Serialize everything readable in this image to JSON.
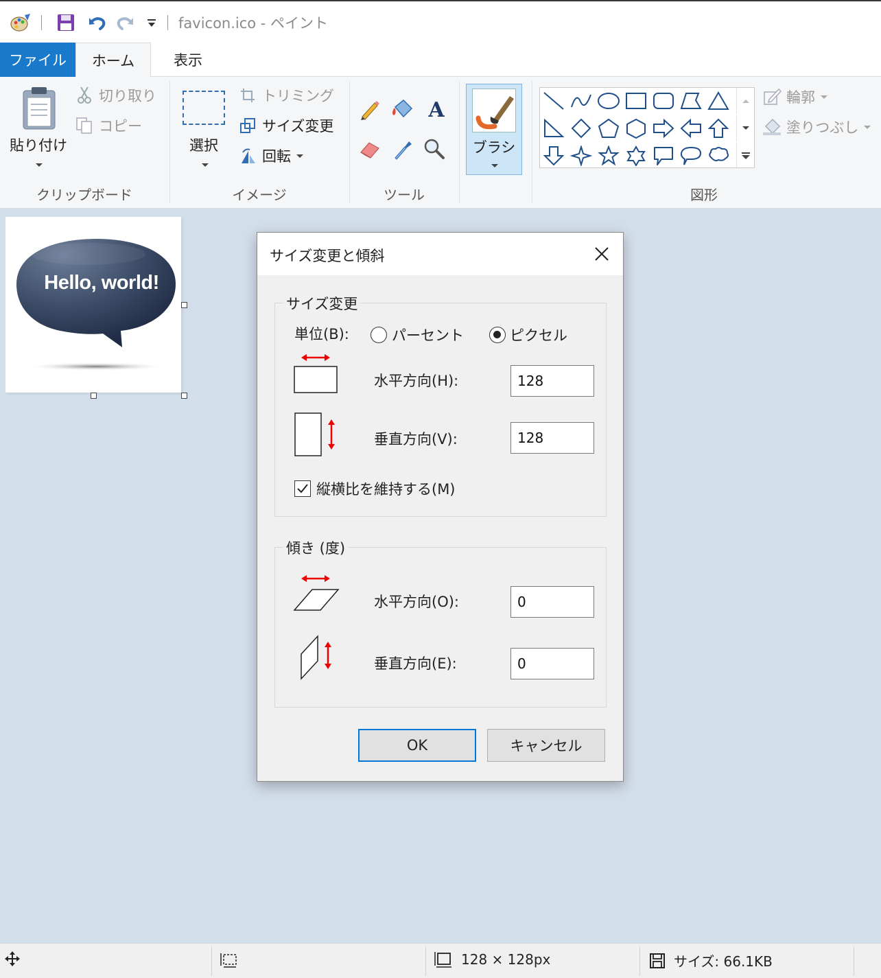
{
  "window": {
    "title": "favicon.ico - ペイント"
  },
  "tabs": {
    "file": "ファイル",
    "home": "ホーム",
    "view": "表示"
  },
  "ribbon": {
    "clipboard": {
      "paste": "貼り付け",
      "cut": "切り取り",
      "copy": "コピー",
      "group": "クリップボード"
    },
    "image": {
      "select": "選択",
      "crop": "トリミング",
      "resize": "サイズ変更",
      "rotate": "回転",
      "group": "イメージ"
    },
    "tools": {
      "group": "ツール"
    },
    "brush": {
      "label": "ブラシ"
    },
    "shapes": {
      "outline": "輪郭",
      "fill": "塗りつぶし",
      "group": "図形"
    }
  },
  "canvas": {
    "image_text": "Hello, world!"
  },
  "dialog": {
    "title": "サイズ変更と傾斜",
    "resize_section": {
      "legend": "サイズ変更",
      "unit_label": "単位(B):",
      "percent_option": "パーセント",
      "pixel_option": "ピクセル",
      "selected_unit": "ピクセル",
      "horizontal_label": "水平方向(H):",
      "horizontal_value": "128",
      "vertical_label": "垂直方向(V):",
      "vertical_value": "128",
      "keep_aspect_label": "縦横比を維持する(M)",
      "keep_aspect_checked": true
    },
    "skew_section": {
      "legend": "傾き (度)",
      "horizontal_label": "水平方向(O):",
      "horizontal_value": "0",
      "vertical_label": "垂直方向(E):",
      "vertical_value": "0"
    },
    "ok": "OK",
    "cancel": "キャンセル"
  },
  "statusbar": {
    "dimensions": "128 × 128px",
    "size": "サイズ: 66.1KB"
  },
  "colors": {
    "accent": "#1979ca",
    "dialog_bg": "#f0f0f0",
    "workspace_bg": "#d3deeb",
    "default_button_border": "#0078d7"
  }
}
